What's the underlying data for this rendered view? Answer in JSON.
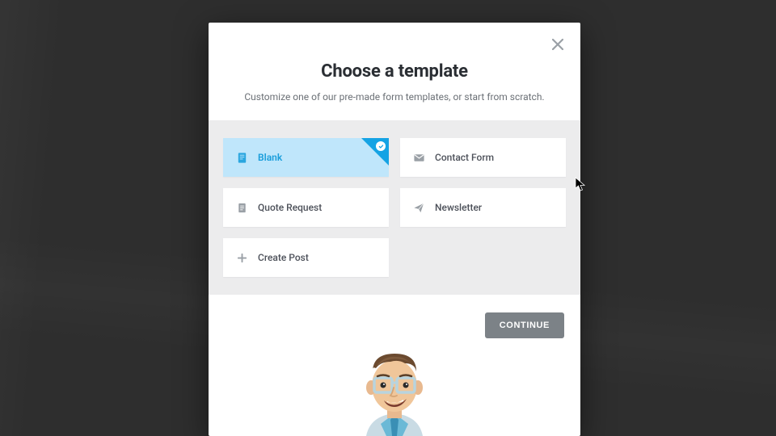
{
  "modal": {
    "title": "Choose a template",
    "subtitle": "Customize one of our pre-made form templates, or start from scratch.",
    "continue_label": "CONTINUE"
  },
  "templates": [
    {
      "label": "Blank",
      "icon": "document-icon",
      "selected": true
    },
    {
      "label": "Contact Form",
      "icon": "mail-icon",
      "selected": false
    },
    {
      "label": "Quote Request",
      "icon": "clipboard-icon",
      "selected": false
    },
    {
      "label": "Newsletter",
      "icon": "paper-plane-icon",
      "selected": false
    },
    {
      "label": "Create Post",
      "icon": "plus-icon",
      "selected": false
    }
  ],
  "colors": {
    "accent": "#15a3e4",
    "selected_bg": "#bfe6fb",
    "button_bg": "#7c8287",
    "icon_muted": "#9aa0a6"
  }
}
